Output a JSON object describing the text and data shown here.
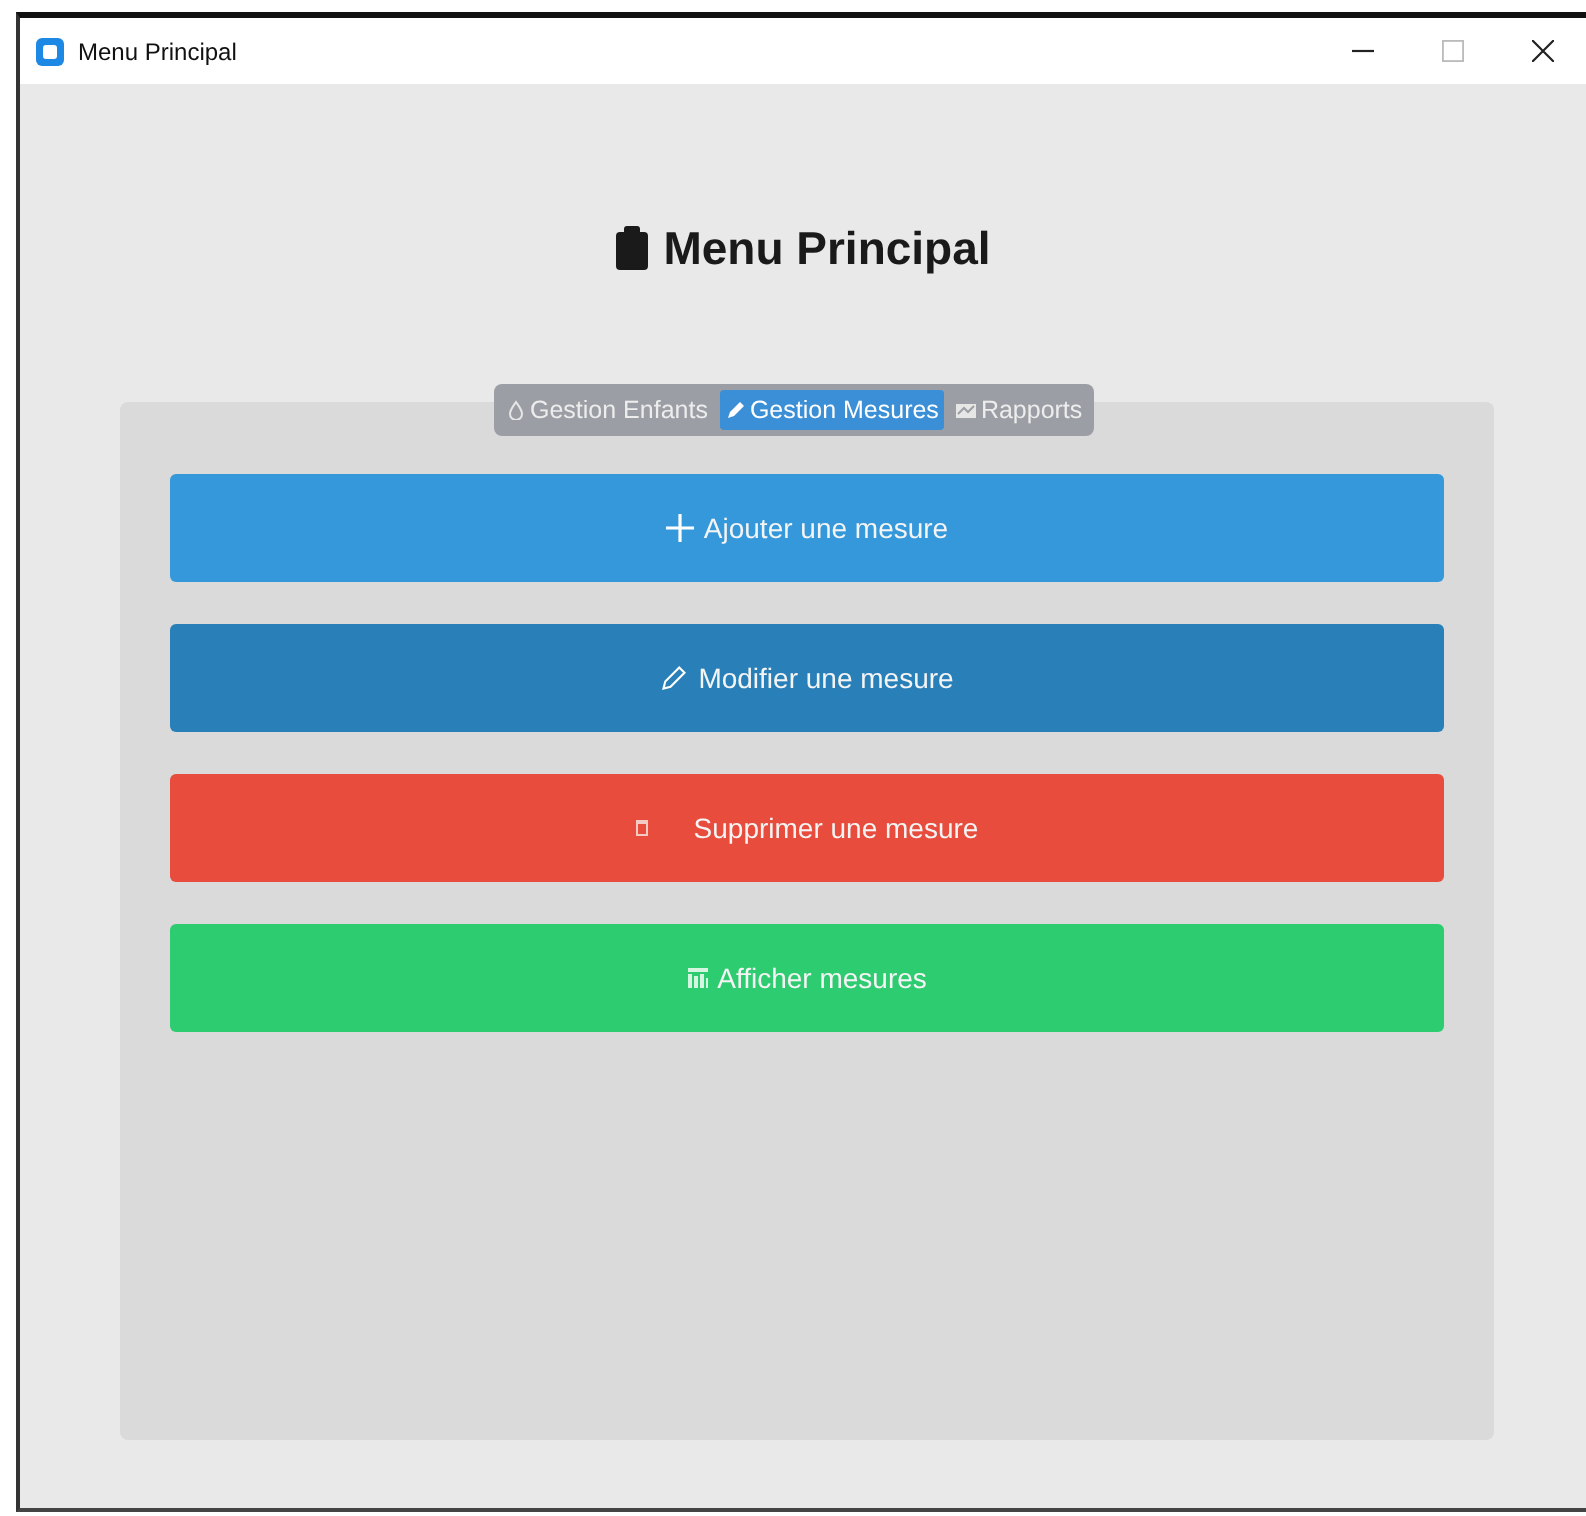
{
  "window": {
    "title": "Menu Principal"
  },
  "heading": "Menu Principal",
  "tabs": [
    {
      "label": "Gestion Enfants",
      "selected": false
    },
    {
      "label": "Gestion Mesures",
      "selected": true
    },
    {
      "label": "Rapports",
      "selected": false
    }
  ],
  "actions": [
    {
      "label": "Ajouter une mesure",
      "color": "#3498db"
    },
    {
      "label": "Modifier une mesure",
      "color": "#2980b9"
    },
    {
      "label": "Supprimer une mesure",
      "color": "#e74c3c"
    },
    {
      "label": "Afficher mesures",
      "color": "#2ecc71"
    }
  ]
}
